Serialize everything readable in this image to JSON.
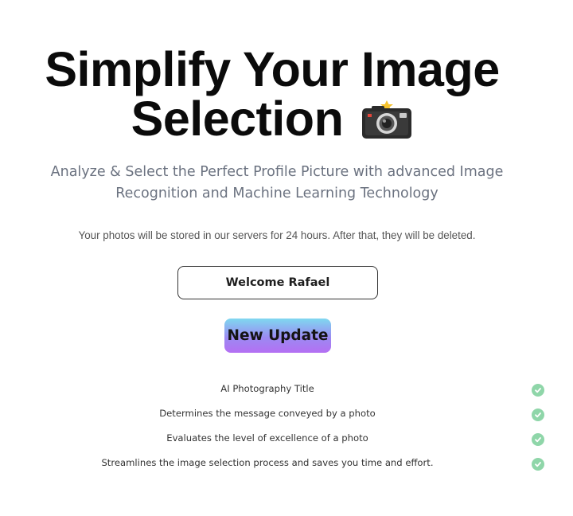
{
  "hero": {
    "title_line1": "Simplify Your Image",
    "title_line2": "Selection",
    "title_icon": "camera-with-flash-icon"
  },
  "subtitle": "Analyze & Select the Perfect Profile Picture with advanced Image Recognition and Machine Learning Technology",
  "storage_note": "Your photos will be stored in our servers for 24 hours. After that, they will be deleted.",
  "welcome": {
    "text": "Welcome Rafael"
  },
  "update_button": {
    "label": "New Update"
  },
  "features": [
    {
      "text": "AI Photography Title",
      "icon": "check-circle-icon"
    },
    {
      "text": "Determines the message conveyed by a photo",
      "icon": "check-circle-icon"
    },
    {
      "text": "Evaluates the level of excellence of a photo",
      "icon": "check-circle-icon"
    },
    {
      "text": "Streamlines the image selection process and saves you time and effort.",
      "icon": "check-circle-icon"
    }
  ],
  "colors": {
    "check": "#8fd6a9",
    "button_gradient_top": "#7fd8f0",
    "button_gradient_bottom": "#b46ff3",
    "subtitle": "#6b7280"
  }
}
